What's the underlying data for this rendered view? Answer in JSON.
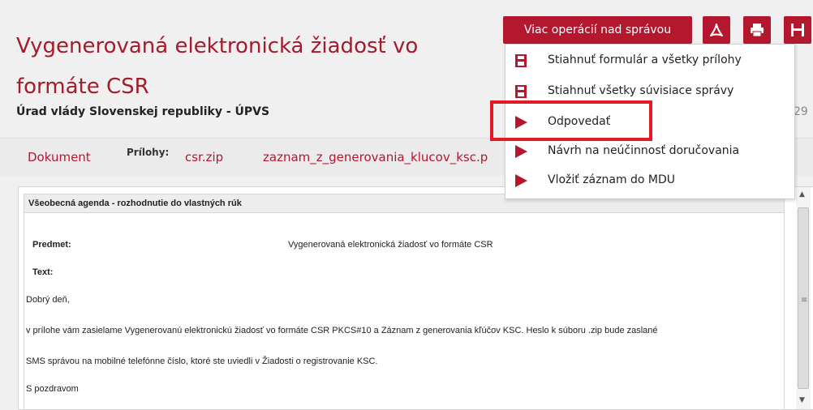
{
  "header": {
    "title": "Vygenerovaná elektronická žiadosť vo formáte CSR",
    "organization": "Úrad vlády Slovenskej republiky - ÚPVS",
    "ref_fragment": "29",
    "ops_button_label": "Viac operácií nad správou"
  },
  "tabs": {
    "document_label": "Dokument",
    "attachments_label": "Prílohy:",
    "attachments": [
      "csr.zip",
      "zaznam_z_generovania_klucov_ksc.p"
    ]
  },
  "menu": {
    "items": [
      {
        "label": "Stiahnuť formulár a všetky prílohy",
        "icon": "save-icon"
      },
      {
        "label": "Stiahnuť všetky súvisiace správy",
        "icon": "save-icon"
      },
      {
        "label": "Odpovedať",
        "icon": "play-icon"
      },
      {
        "label": "Návrh na neúčinnosť doručovania",
        "icon": "play-icon"
      },
      {
        "label": "Vložiť záznam do MDU",
        "icon": "play-icon"
      }
    ]
  },
  "message": {
    "agenda": "Všeobecná agenda - rozhodnutie do vlastných rúk",
    "subject_label": "Predmet:",
    "subject_value": "Vygenerovaná elektronická žiadosť vo formáte CSR",
    "text_label": "Text:",
    "greeting": "Dobrý deň,",
    "line1": "v prílohe vám zasielame Vygenerovanú elektronickú žiadosť vo formáte CSR PKCS#10 a Záznam z generovania kľúčov KSC. Heslo k súboru .zip bude zaslané",
    "line2": "SMS správou na mobilné telefónne číslo, ktoré ste uviedli v Žiadosti o registrovanie KSC.",
    "closing": "S pozdravom"
  },
  "colors": {
    "accent": "#b3182f",
    "highlight": "#e21a25"
  }
}
